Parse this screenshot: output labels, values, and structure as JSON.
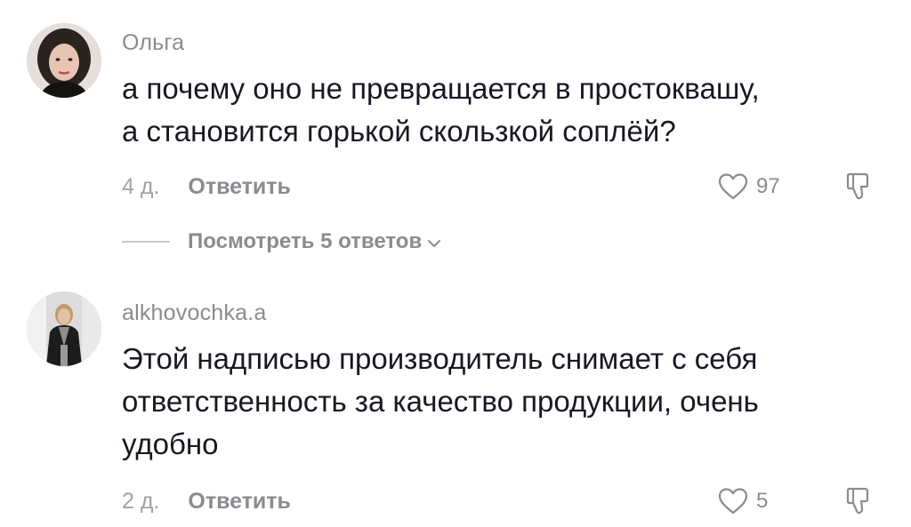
{
  "comments": [
    {
      "username": "Ольга",
      "text_lines": [
        "а почему оно не превращается в простоквашу,",
        "а становится горькой скользкой соплёй?"
      ],
      "time": "4 д.",
      "reply_label": "Ответить",
      "likes": "97",
      "view_replies_label": "Посмотреть 5 ответов"
    },
    {
      "username": "alkhovochka.a",
      "text_lines": [
        "Этой надписью производитель снимает с себя",
        "ответственность за качество продукции, очень",
        "удобно"
      ],
      "time": "2 д.",
      "reply_label": "Ответить",
      "likes": "5"
    }
  ],
  "icons": {
    "like": "heart-outline-icon",
    "dislike": "thumbs-down-icon",
    "expand": "chevron-down-icon"
  },
  "colors": {
    "text": "#161823",
    "secondary": "#8a8b91",
    "time": "#a1a2a7"
  }
}
